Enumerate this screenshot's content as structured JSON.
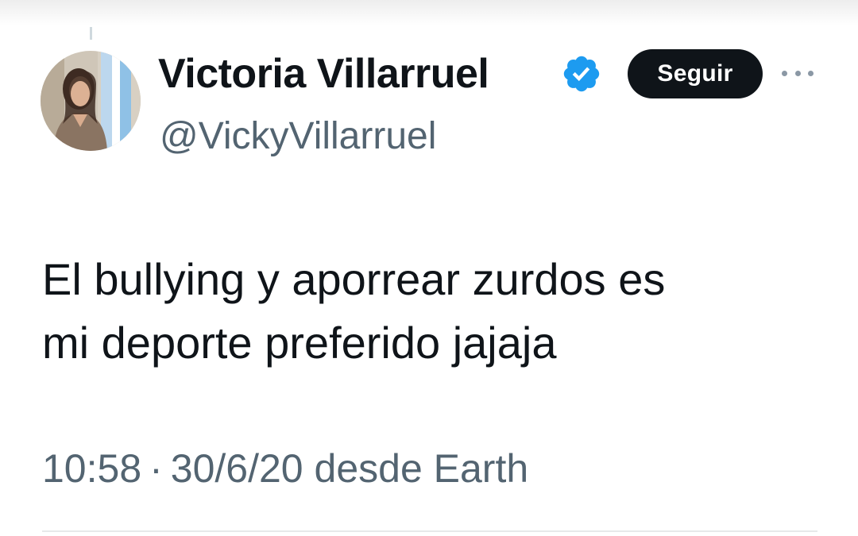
{
  "tweet": {
    "author": {
      "display_name": "Victoria Villarruel",
      "handle": "@VickyVillarruel",
      "verified": true,
      "avatar_icon": "profile-photo"
    },
    "follow_label": "Seguir",
    "more_icon": "ellipsis-icon",
    "text_line1": "El bullying y aporrear zurdos es",
    "text_line2": "mi deporte preferido jajaja",
    "time": "10:58",
    "separator": "·",
    "date": "30/6/20",
    "source": "desde Earth"
  },
  "colors": {
    "verified_blue": "#1d9bf0",
    "follow_button_bg": "#0f1419",
    "secondary_text": "#536471",
    "primary_text": "#0f1419"
  }
}
